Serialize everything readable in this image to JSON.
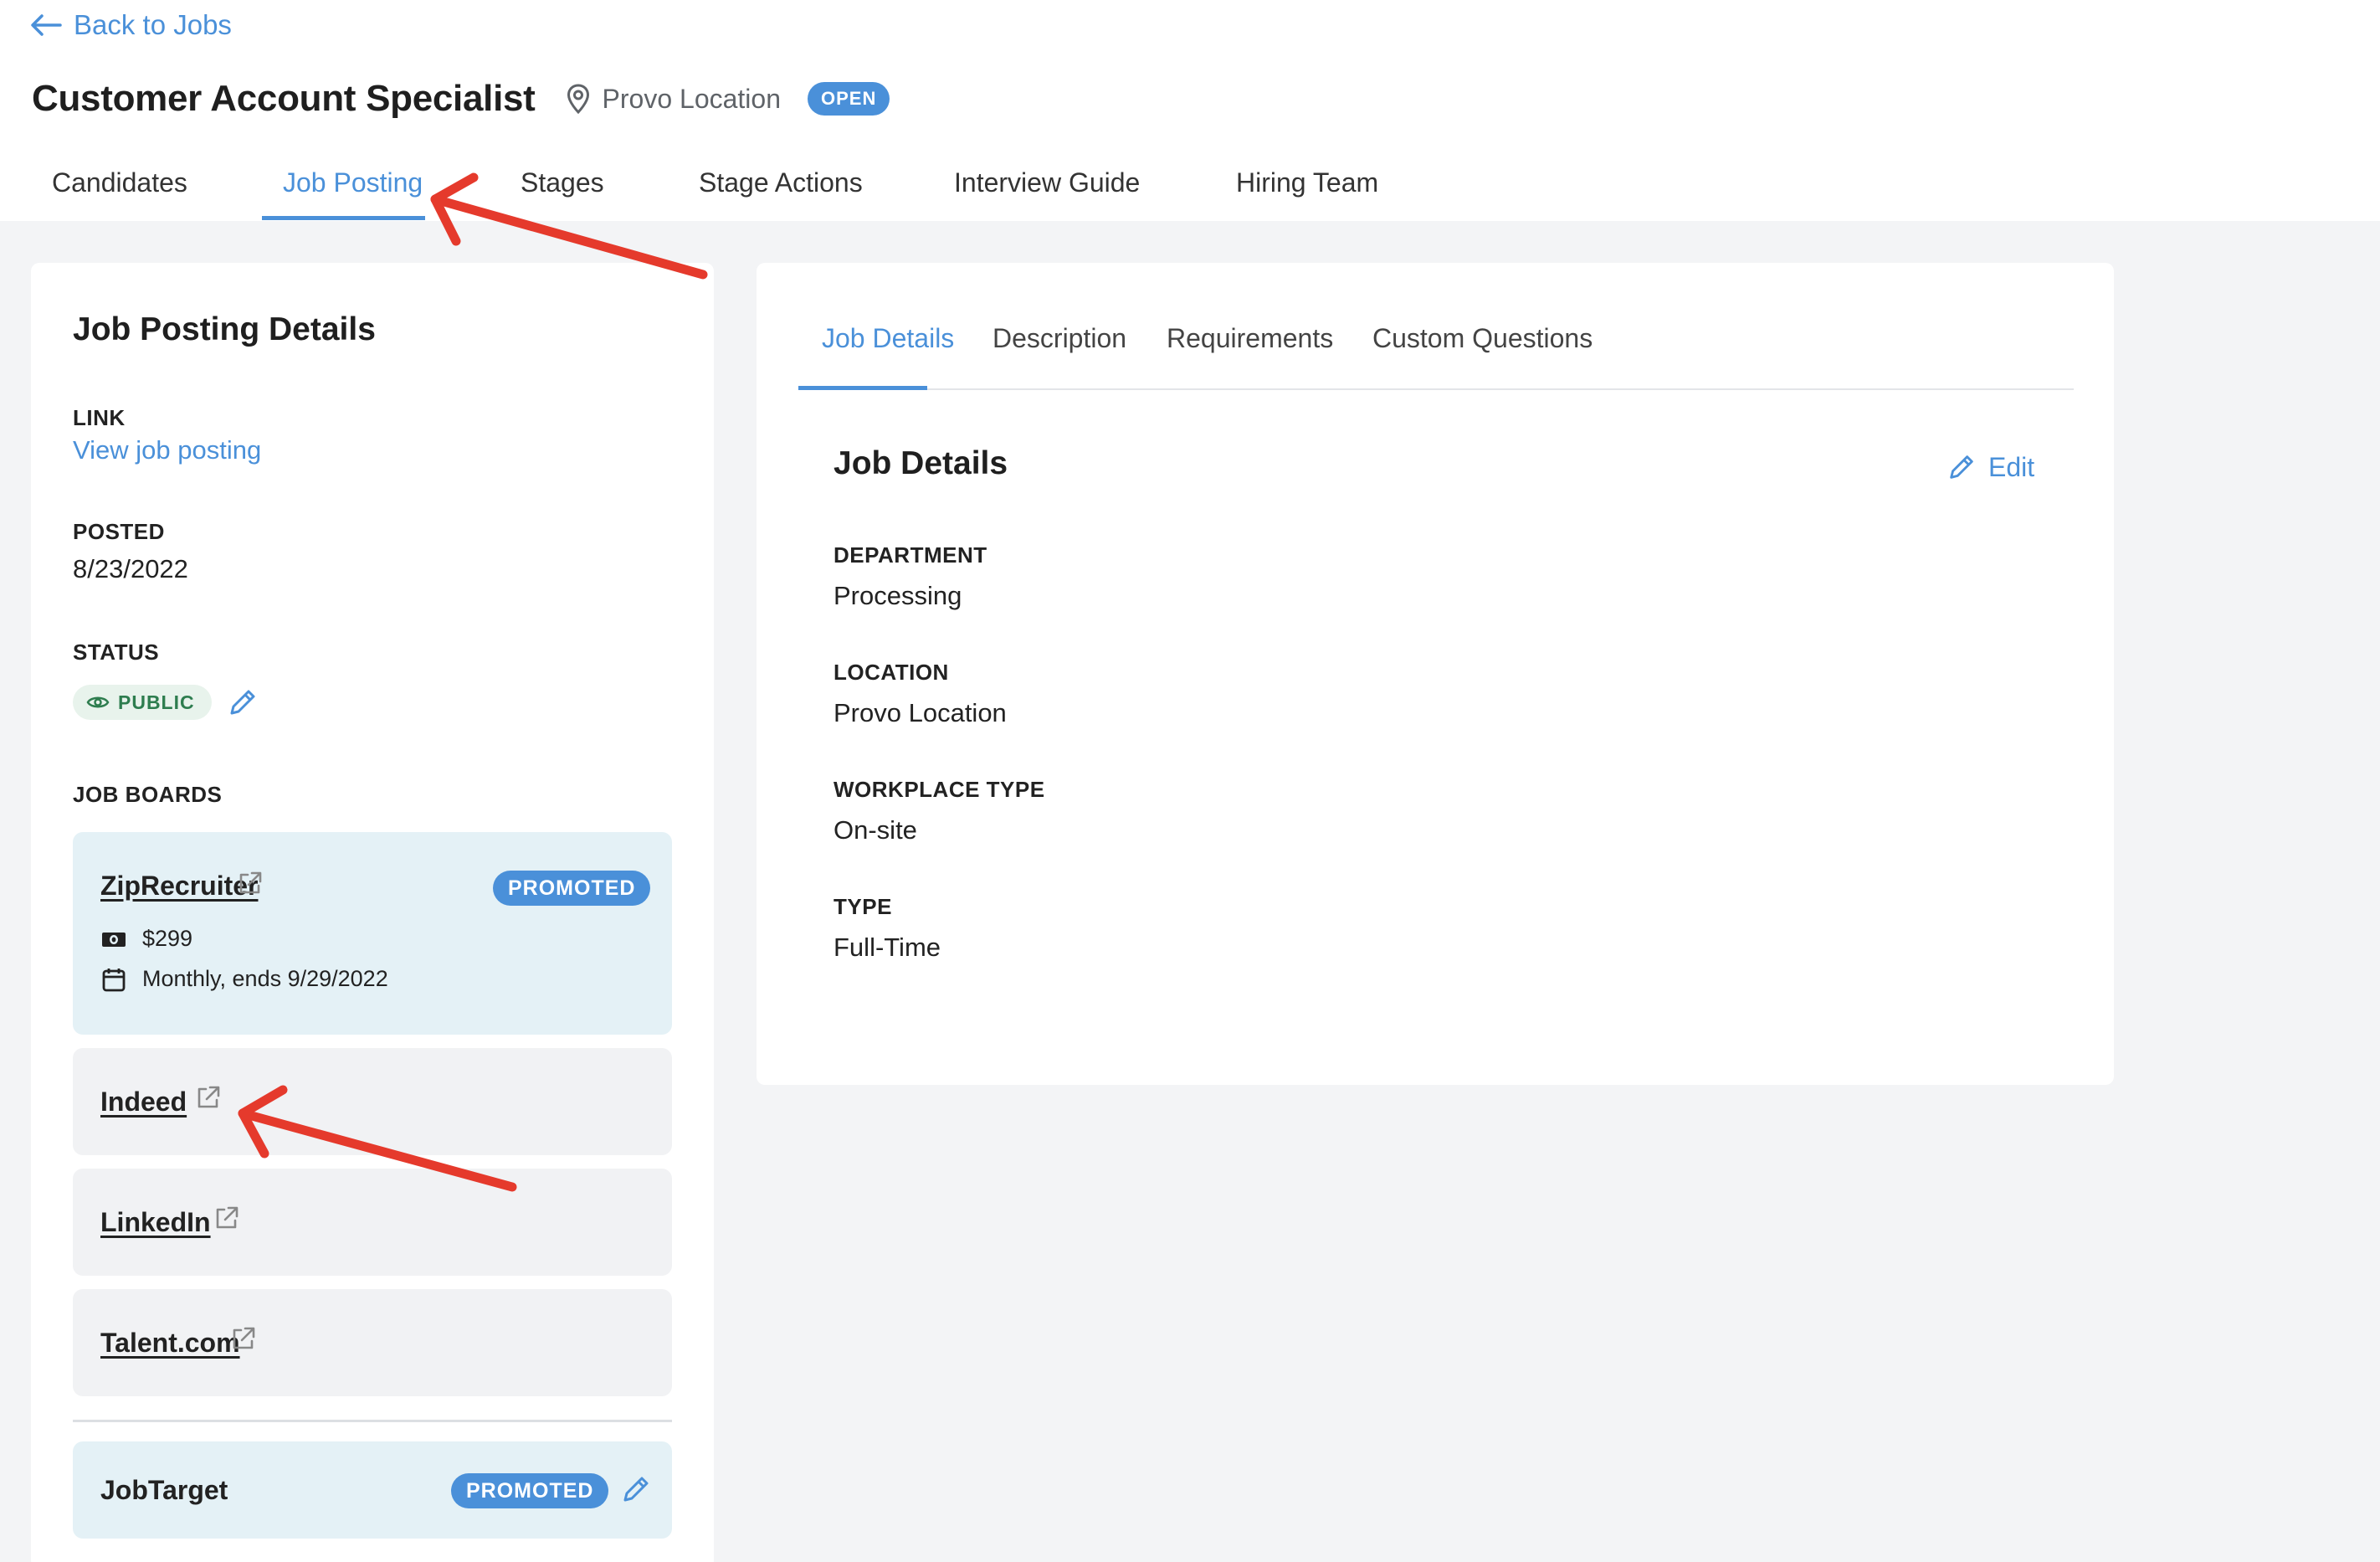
{
  "header": {
    "back_label": "Back to Jobs",
    "job_title": "Customer Account Specialist",
    "location": "Provo Location",
    "status_badge": "OPEN"
  },
  "main_tabs": [
    {
      "label": "Candidates",
      "active": false
    },
    {
      "label": "Job Posting",
      "active": true
    },
    {
      "label": "Stages",
      "active": false
    },
    {
      "label": "Stage Actions",
      "active": false
    },
    {
      "label": "Interview Guide",
      "active": false
    },
    {
      "label": "Hiring Team",
      "active": false
    }
  ],
  "posting": {
    "heading": "Job Posting Details",
    "link_label": "LINK",
    "link_text": "View job posting",
    "posted_label": "POSTED",
    "posted_value": "8/23/2022",
    "status_label": "STATUS",
    "status_value": "PUBLIC",
    "boards_label": "JOB BOARDS",
    "boards": [
      {
        "name": "ZipRecruiter",
        "badge": "PROMOTED",
        "price": "$299",
        "schedule": "Monthly, ends 9/29/2022"
      },
      {
        "name": "Indeed"
      },
      {
        "name": "LinkedIn"
      },
      {
        "name": "Talent.com"
      },
      {
        "name": "JobTarget",
        "badge": "PROMOTED"
      }
    ]
  },
  "details": {
    "tabs": [
      {
        "label": "Job Details",
        "active": true
      },
      {
        "label": "Description",
        "active": false
      },
      {
        "label": "Requirements",
        "active": false
      },
      {
        "label": "Custom Questions",
        "active": false
      }
    ],
    "heading": "Job Details",
    "edit_label": "Edit",
    "fields": [
      {
        "label": "DEPARTMENT",
        "value": "Processing"
      },
      {
        "label": "LOCATION",
        "value": "Provo Location"
      },
      {
        "label": "WORKPLACE TYPE",
        "value": "On-site"
      },
      {
        "label": "TYPE",
        "value": "Full-Time"
      }
    ]
  },
  "colors": {
    "accent": "#4a90d9",
    "promoted_bg": "#e4f1f6",
    "board_bg": "#f1f2f4",
    "public_bg": "#e8f3ec",
    "public_text": "#2e7d4f",
    "annotation_arrow": "#e53a2c",
    "page_bg": "#f3f4f6"
  },
  "icons": [
    "arrow-left-icon",
    "location-pin-icon",
    "eye-icon",
    "pencil-icon",
    "external-link-icon",
    "money-icon",
    "calendar-icon"
  ]
}
